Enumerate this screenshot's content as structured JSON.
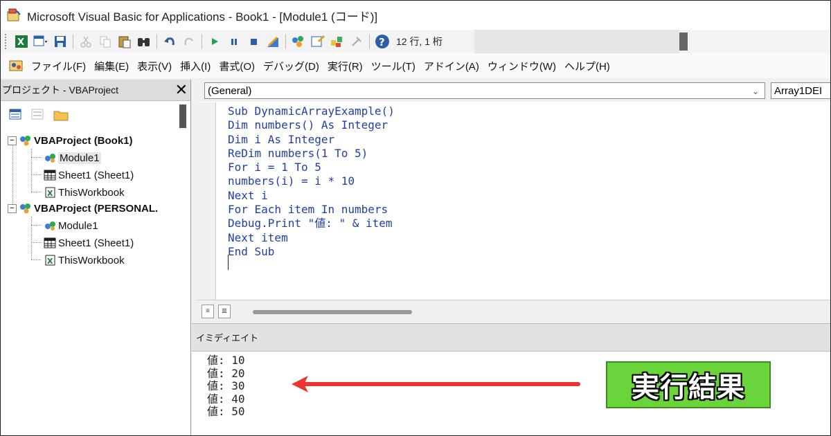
{
  "window": {
    "title": "Microsoft Visual Basic for Applications - Book1 - [Module1 (コード)]"
  },
  "toolbar": {
    "cursor_position": "12 行, 1 桁",
    "buttons": [
      "excel-icon",
      "insert-userform-icon",
      "save-icon",
      "cut-icon",
      "copy-icon",
      "paste-icon",
      "find-icon",
      "undo-icon",
      "redo-icon",
      "run-icon",
      "break-icon",
      "reset-icon",
      "design-mode-icon",
      "project-explorer-icon",
      "properties-icon",
      "object-browser-icon",
      "toolbox-icon",
      "help-icon"
    ]
  },
  "menu": {
    "items": [
      "ファイル(F)",
      "編集(E)",
      "表示(V)",
      "挿入(I)",
      "書式(O)",
      "デバッグ(D)",
      "実行(R)",
      "ツール(T)",
      "アドイン(A)",
      "ウィンドウ(W)",
      "ヘルプ(H)"
    ]
  },
  "project": {
    "title": "プロジェクト - VBAProject",
    "close": "✕",
    "tree": [
      {
        "label": "VBAProject (Book1)",
        "bold": true
      },
      {
        "label": "Module1",
        "selected": true
      },
      {
        "label": "Sheet1 (Sheet1)"
      },
      {
        "label": "ThisWorkbook"
      },
      {
        "label": "VBAProject (PERSONAL.",
        "bold": true
      },
      {
        "label": "Module1"
      },
      {
        "label": "Sheet1 (Sheet1)"
      },
      {
        "label": "ThisWorkbook"
      }
    ]
  },
  "code": {
    "object_combo": "(General)",
    "proc_combo": "Array1DEI",
    "lines": [
      "Sub DynamicArrayExample()",
      "Dim numbers() As Integer",
      "Dim i As Integer",
      "ReDim numbers(1 To 5)",
      "For i = 1 To 5",
      "numbers(i) = i * 10",
      "Next i",
      "For Each item In numbers",
      "Debug.Print \"値: \" & item",
      "Next item",
      "End Sub"
    ]
  },
  "immediate": {
    "title": "イミディエイト",
    "lines": [
      "値: 10",
      "値: 20",
      "値: 30",
      "値: 40",
      "値: 50"
    ]
  },
  "annotation": {
    "label": "実行結果",
    "arrow_color": "#ee3333",
    "badge_color": "#6ad53a"
  }
}
